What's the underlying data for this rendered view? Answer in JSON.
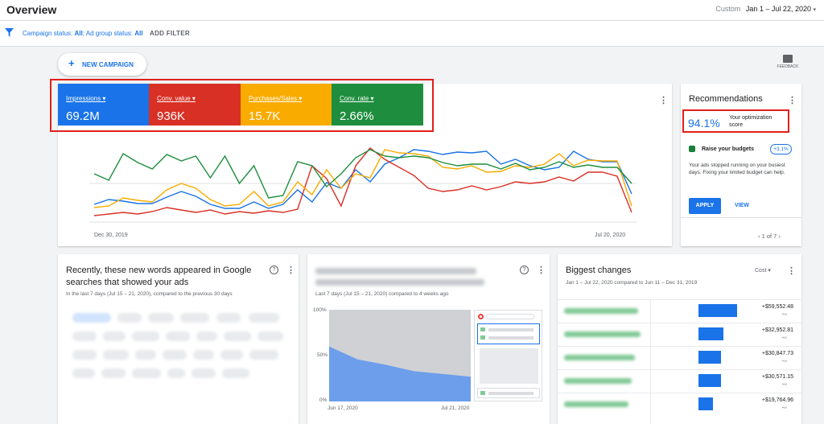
{
  "header": {
    "title": "Overview",
    "range_label": "Custom",
    "range_value": "Jan 1 – Jul 22, 2020"
  },
  "filters": {
    "campaign_status": "Campaign status:",
    "campaign_status_value": "All",
    "ad_group_status": "Ad group status:",
    "ad_group_status_value": "All",
    "add_filter": "ADD FILTER"
  },
  "actions": {
    "new_campaign": "NEW CAMPAIGN",
    "feedback": "FEEDBACK"
  },
  "colors": {
    "impressions": "#1a73e8",
    "conv_value": "#d93025",
    "purchases": "#f9ab00",
    "conv_rate": "#1e8e3e",
    "highlight": "#e0201c"
  },
  "metrics": [
    {
      "label": "Impressions",
      "value": "69.2M"
    },
    {
      "label": "Conv. value",
      "value": "936K"
    },
    {
      "label": "Purchases/Sales",
      "value": "15.7K"
    },
    {
      "label": "Conv. rate",
      "value": "2.66%"
    }
  ],
  "chart_data": {
    "type": "line",
    "x_start": "Dec 30, 2019",
    "x_end": "Jul 20, 2020",
    "x_tick_labels": [
      "Dec 30, 2019",
      "Jul 20, 2020"
    ],
    "series": [
      {
        "name": "Impressions",
        "values": [
          22,
          28,
          26,
          23,
          23,
          31,
          38,
          32,
          22,
          17,
          17,
          25,
          17,
          22,
          40,
          25,
          49,
          42,
          65,
          50,
          72,
          80,
          90,
          88,
          84,
          87,
          86,
          88,
          72,
          78,
          70,
          65,
          68,
          88,
          78,
          75,
          75,
          35
        ]
      },
      {
        "name": "Conv. value",
        "values": [
          8,
          10,
          12,
          10,
          13,
          18,
          15,
          12,
          15,
          10,
          13,
          11,
          14,
          12,
          16,
          70,
          54,
          20,
          70,
          92,
          78,
          68,
          58,
          42,
          38,
          40,
          45,
          40,
          44,
          50,
          48,
          50,
          56,
          51,
          62,
          62,
          57,
          12
        ]
      },
      {
        "name": "Purchases/Sales",
        "values": [
          18,
          20,
          30,
          27,
          25,
          40,
          48,
          42,
          28,
          20,
          22,
          38,
          20,
          25,
          50,
          34,
          65,
          42,
          60,
          55,
          90,
          86,
          85,
          82,
          68,
          66,
          70,
          62,
          63,
          70,
          68,
          72,
          85,
          70,
          77,
          76,
          76,
          20
        ]
      },
      {
        "name": "Conv. rate",
        "values": [
          60,
          52,
          85,
          74,
          66,
          84,
          76,
          82,
          55,
          82,
          48,
          70,
          30,
          33,
          75,
          70,
          44,
          60,
          80,
          90,
          82,
          80,
          82,
          80,
          74,
          70,
          72,
          72,
          66,
          73,
          65,
          68,
          75,
          68,
          71,
          68,
          68,
          48
        ]
      }
    ],
    "grid": true
  },
  "recommendations": {
    "title": "Recommendations",
    "score": "94.1%",
    "score_label": "Your optimization score",
    "item_title": "Raise your budgets",
    "item_gain": "+3.1%",
    "item_desc": "Your ads stopped running on your busiest days. Fixing your limited budget can help.",
    "apply": "APPLY",
    "view": "VIEW",
    "pager": "1 of 7"
  },
  "new_words": {
    "title": "Recently, these new words appeared in Google searches that showed your ads",
    "subtitle": "In the last 7 days (Jul 15 – 21, 2020), compared to the previous 30 days"
  },
  "search_share": {
    "subtitle": "Last 7 days (Jul 15 – 21, 2020) compared to 4 weeks ago",
    "y_top": "100%",
    "y_mid": "50%",
    "y_bottom": "0%",
    "x_start": "Jun 17, 2020",
    "x_end": "Jul 21, 2020",
    "area_values": [
      60,
      46,
      40,
      33,
      30,
      27
    ]
  },
  "changes": {
    "title": "Biggest changes",
    "subtitle": "Jan 1 – Jul 22, 2020 compared to Jun 11 – Dec 31, 2019",
    "metric": "Cost",
    "rows": [
      {
        "amount": "+$59,552.48",
        "share": 1.0,
        "note": "+∞"
      },
      {
        "amount": "+$32,952.81",
        "share": 0.64,
        "note": "+∞"
      },
      {
        "amount": "+$30,847.73",
        "share": 0.58,
        "note": "+∞"
      },
      {
        "amount": "+$30,571.15",
        "share": 0.58,
        "note": "+∞"
      },
      {
        "amount": "+$19,764.96",
        "share": 0.38,
        "note": "+∞"
      }
    ]
  }
}
